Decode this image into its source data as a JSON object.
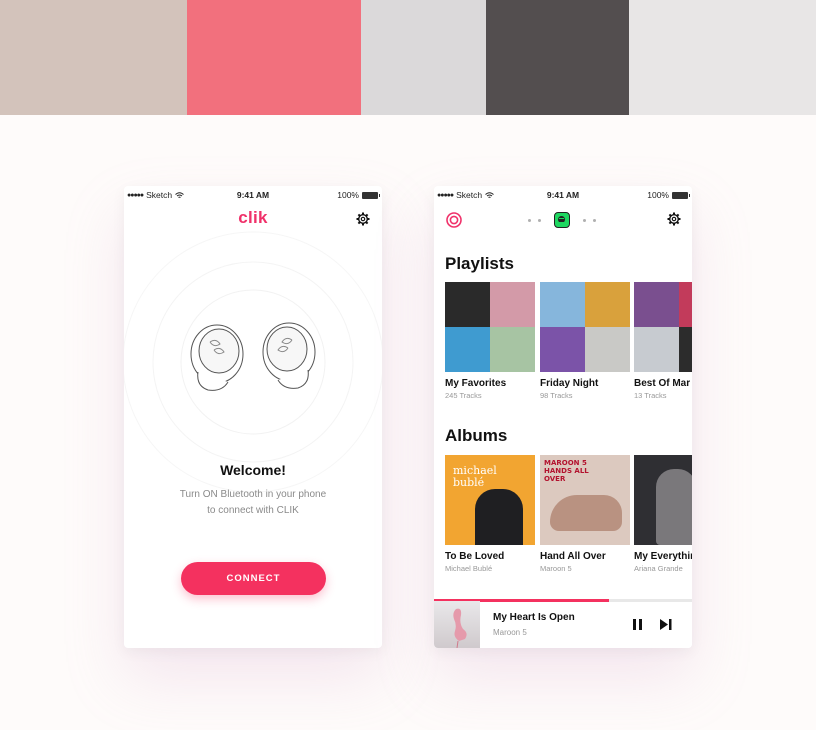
{
  "palette": [
    "#d3c3bb",
    "#f2707d",
    "#dbd9da",
    "#534e4f",
    "#e8e6e6"
  ],
  "status_bar": {
    "carrier": "Sketch",
    "time": "9:41 AM",
    "battery": "100%"
  },
  "connect_screen": {
    "logo": "clik",
    "welcome": "Welcome!",
    "description_line1": "Turn ON Bluetooth in your phone",
    "description_line2": "to connect with CLIK",
    "connect_button": "CONNECT"
  },
  "music_screen": {
    "playlists_title": "Playlists",
    "playlists": [
      {
        "title": "My Favorites",
        "sub": "245 Tracks",
        "tiles": [
          "#2a2a2a",
          "#d39aa8",
          "#3f9bd0",
          "#a7c4a3"
        ]
      },
      {
        "title": "Friday Night",
        "sub": "98 Tracks",
        "tiles": [
          "#86b6dc",
          "#d9a13c",
          "#7b53a8",
          "#c9c9c6"
        ]
      },
      {
        "title": "Best Of Mar",
        "sub": "13 Tracks",
        "tiles": [
          "#7a4f8f",
          "#c23b5b",
          "#c7cbd0",
          "#2c2c2c"
        ]
      }
    ],
    "albums_title": "Albums",
    "albums": [
      {
        "title": "To Be Loved",
        "sub": "Michael Bublé",
        "color": "#f2a531",
        "cover_text": "michael bublé"
      },
      {
        "title": "Hand All Over",
        "sub": "Maroon 5",
        "color": "#dcc9bf",
        "cover_text": "MAROON 5 HANDS ALL OVER"
      },
      {
        "title": "My Everythin",
        "sub": "Ariana Grande",
        "color": "#2f2f33",
        "cover_text": ""
      }
    ],
    "now_playing": {
      "title": "My Heart Is Open",
      "artist": "Maroon 5",
      "progress": 0.68
    }
  }
}
